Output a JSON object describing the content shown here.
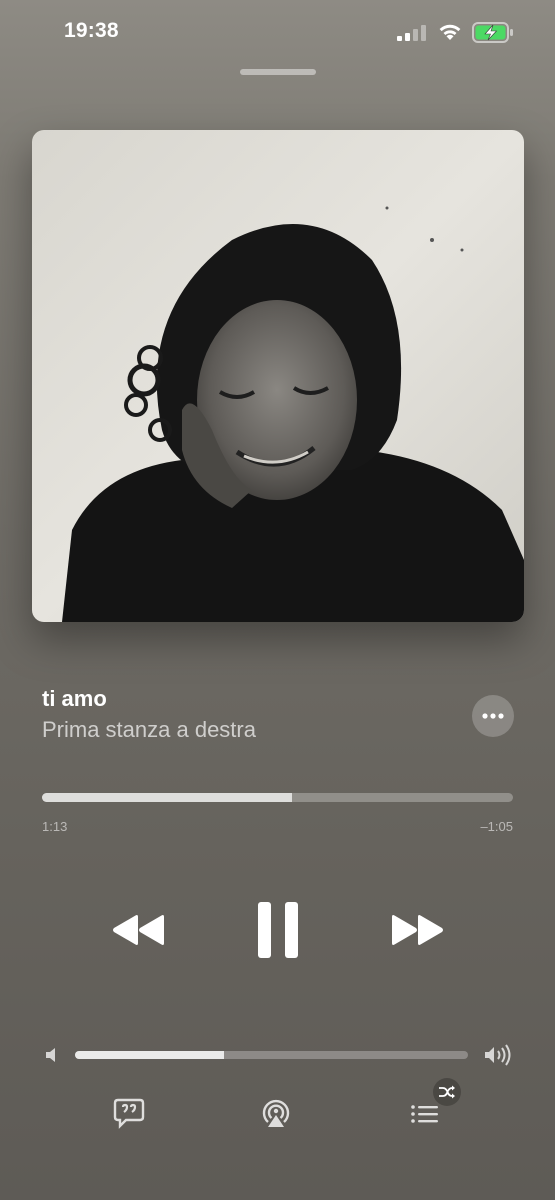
{
  "status_bar": {
    "time": "19:38",
    "icons": [
      "cellular-signal-icon",
      "wifi-icon",
      "battery-charging-icon"
    ],
    "battery_color": "#4cd964"
  },
  "player": {
    "song_title": "ti amo",
    "artist": "Prima stanza a destra",
    "progress": {
      "elapsed": "1:13",
      "remaining": "–1:05",
      "fraction": 0.53
    },
    "volume_fraction": 0.38,
    "controls": [
      "rewind-icon",
      "pause-icon",
      "fast-forward-icon"
    ],
    "bottom_actions": [
      "lyrics-icon",
      "airplay-icon",
      "queue-icon",
      "shuffle-icon"
    ],
    "accent_color": "#ffffff"
  }
}
